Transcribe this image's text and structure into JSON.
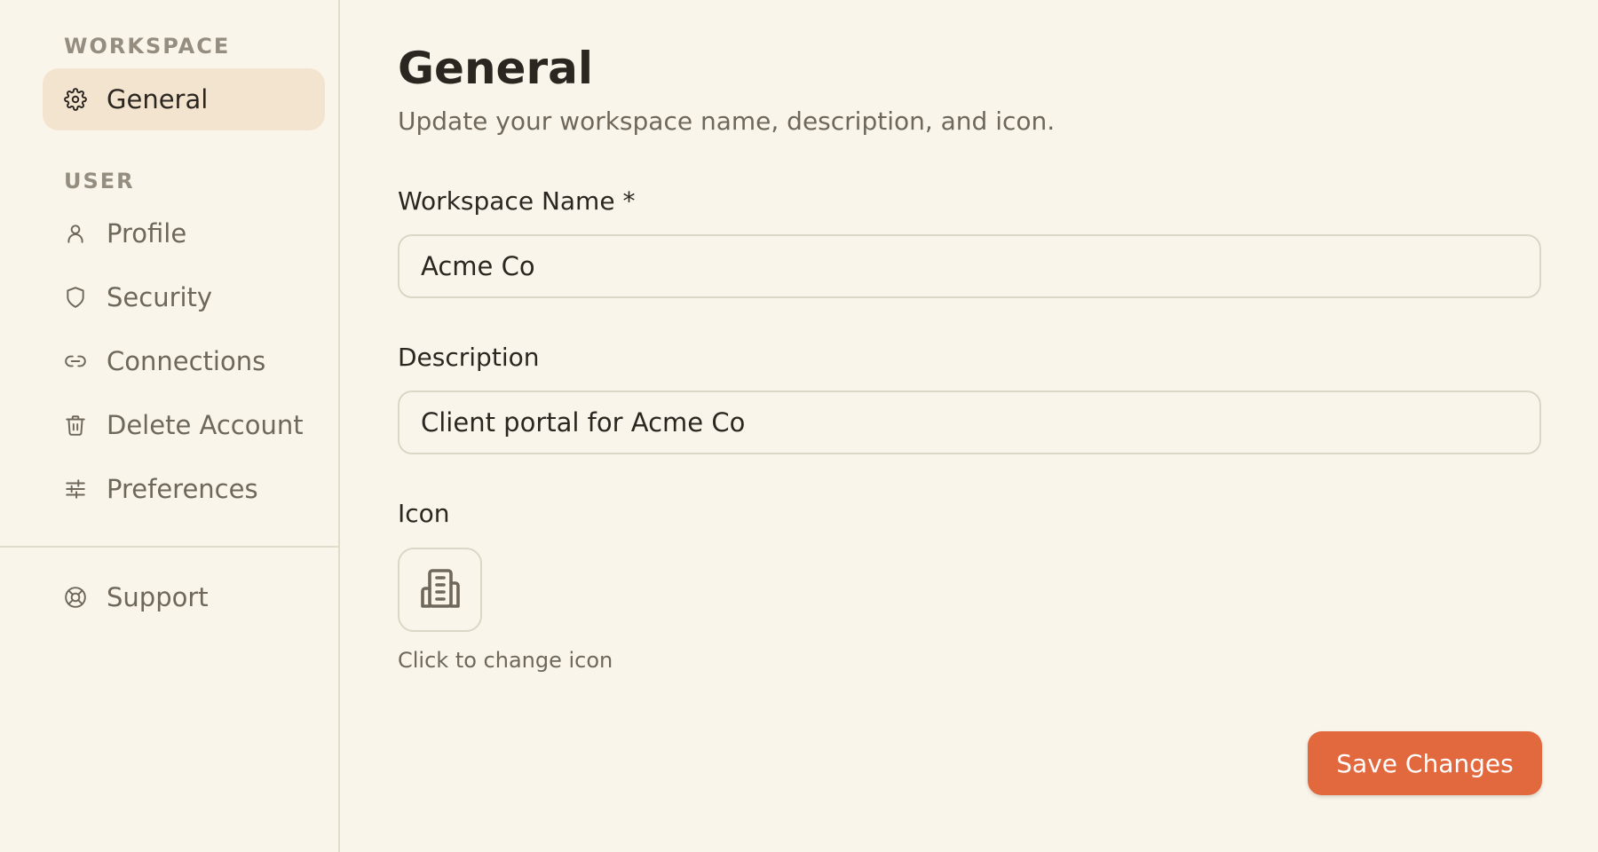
{
  "sidebar": {
    "workspace_label": "WORKSPACE",
    "user_label": "USER",
    "workspace_items": [
      {
        "label": "General",
        "icon": "gear-icon",
        "active": true
      }
    ],
    "user_items": [
      {
        "label": "Profile",
        "icon": "user-icon"
      },
      {
        "label": "Security",
        "icon": "shield-icon"
      },
      {
        "label": "Connections",
        "icon": "link-icon"
      },
      {
        "label": "Delete Account",
        "icon": "trash-icon"
      },
      {
        "label": "Preferences",
        "icon": "sliders-icon"
      }
    ],
    "footer_items": [
      {
        "label": "Support",
        "icon": "lifebuoy-icon"
      }
    ]
  },
  "main": {
    "title": "General",
    "subtitle": "Update your workspace name, description, and icon.",
    "workspace_name": {
      "label": "Workspace Name *",
      "value": "Acme Co"
    },
    "description": {
      "label": "Description",
      "value": "Client portal for Acme Co"
    },
    "icon": {
      "label": "Icon",
      "hint": "Click to change icon",
      "icon": "building-icon"
    },
    "save_label": "Save Changes"
  },
  "colors": {
    "background": "#faf5ea",
    "active_item_bg": "#f3e4cf",
    "accent": "#e2683e",
    "border": "#dcd6c6"
  }
}
